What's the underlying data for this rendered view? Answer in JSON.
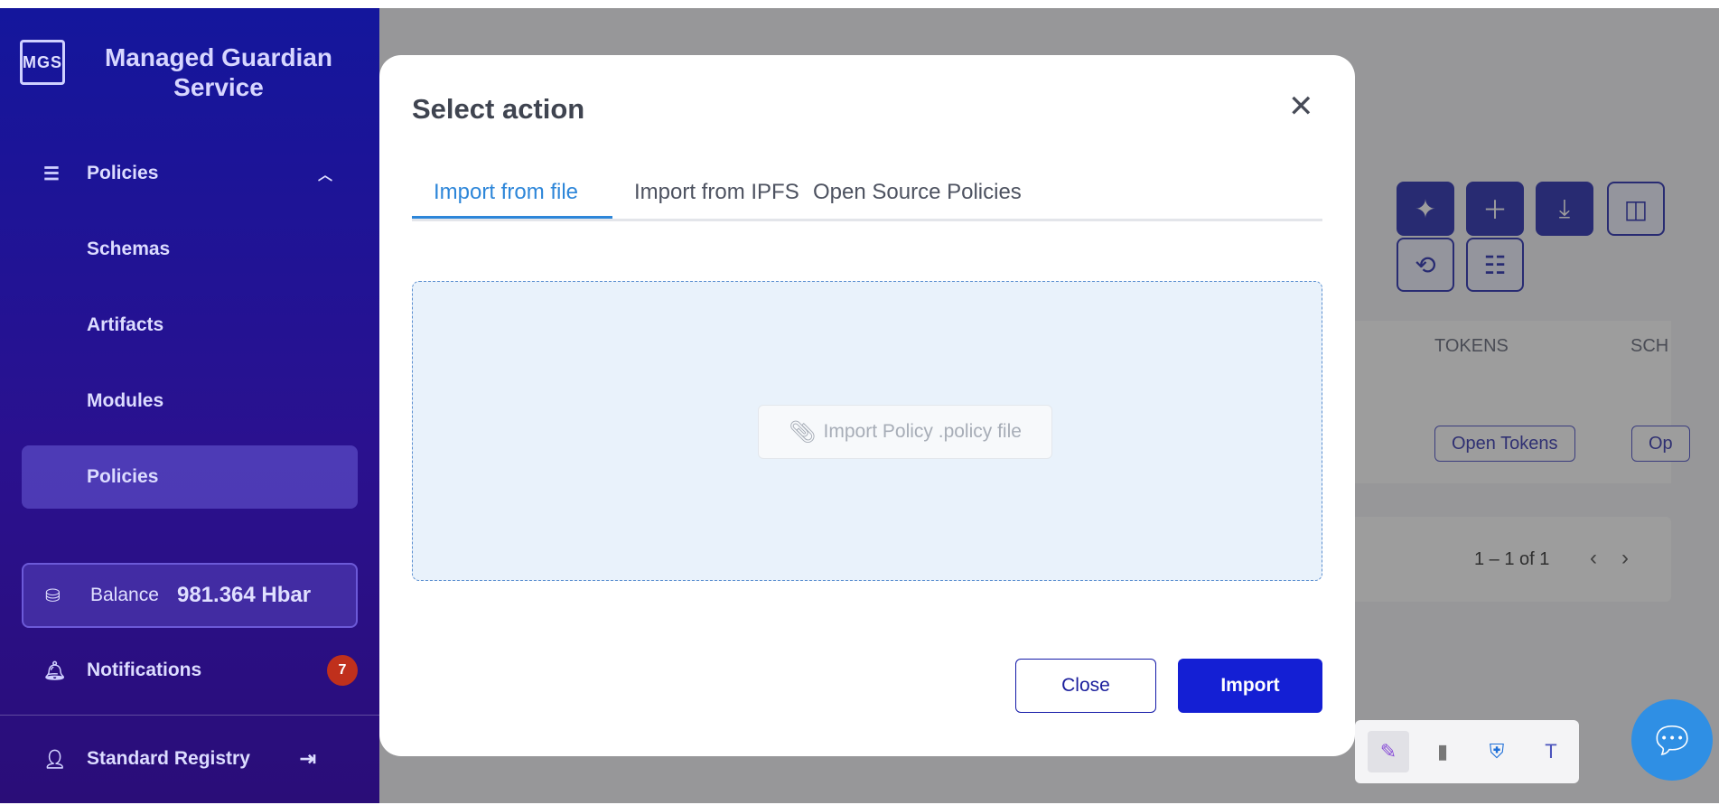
{
  "app": {
    "brand_logo": "MGS",
    "brand_title": "Managed Guardian Service"
  },
  "sidebar": {
    "items": [
      {
        "label": "Policies",
        "icon": "list-icon",
        "expanded": true
      },
      {
        "label": "Schemas"
      },
      {
        "label": "Artifacts"
      },
      {
        "label": "Modules"
      },
      {
        "label": "Policies",
        "active": true
      }
    ],
    "balance": {
      "label": "Balance",
      "value": "981.364 Hbar",
      "icon": "coins-icon"
    },
    "notifications": {
      "label": "Notifications",
      "count": "7",
      "icon": "bell-icon"
    },
    "user": {
      "label": "Standard Registry",
      "icon": "user-icon"
    }
  },
  "background": {
    "table_headers": [
      "TOKENS",
      "SCH"
    ],
    "row_buttons": [
      "Open Tokens",
      "Op"
    ],
    "pagination": "1 – 1 of 1"
  },
  "modal": {
    "title": "Select action",
    "tabs": [
      "Import from file",
      "Import from IPFS",
      "Open Source Policies"
    ],
    "active_tab": 0,
    "dropzone_label": "Import Policy .policy file",
    "close_label": "Close",
    "import_label": "Import"
  },
  "colors": {
    "primary": "#141fd4",
    "tab_active": "#2d86d9",
    "sidebar_top": "#14169c",
    "badge": "#c0301c"
  }
}
